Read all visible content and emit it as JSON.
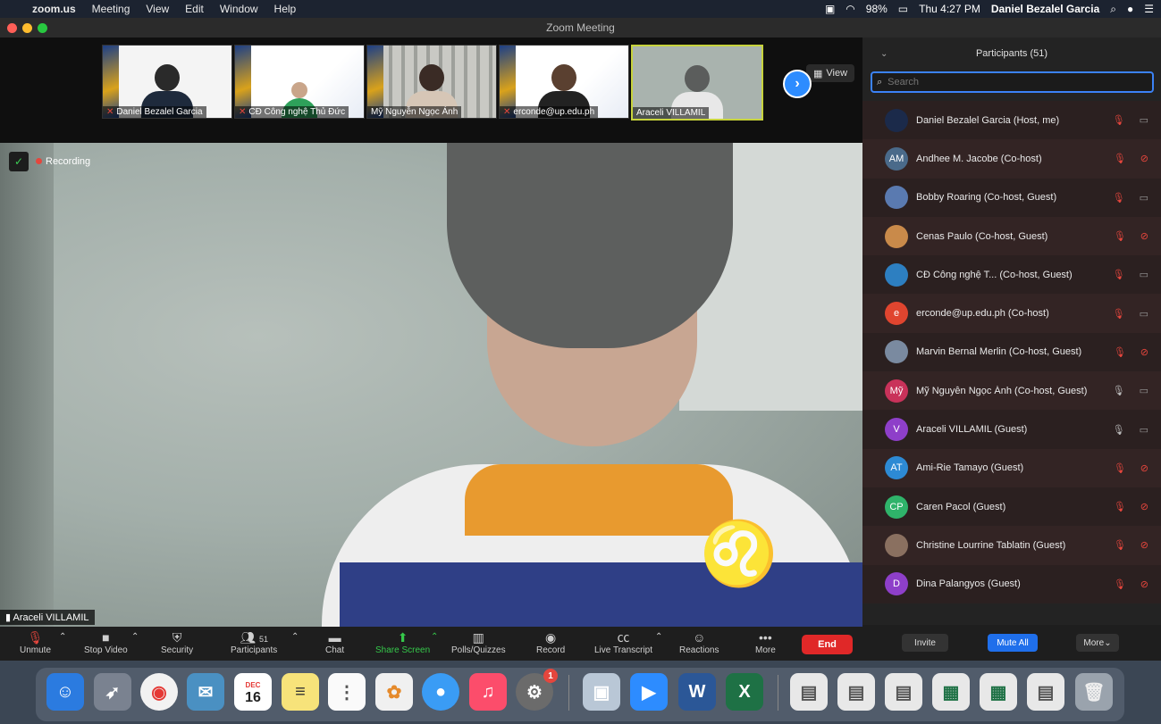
{
  "menubar": {
    "app": "zoom.us",
    "items": [
      "Meeting",
      "View",
      "Edit",
      "Window",
      "Help"
    ],
    "battery": "98%",
    "clock": "Thu 4:27 PM",
    "user": "Daniel Bezalel Garcia"
  },
  "window": {
    "title": "Zoom Meeting"
  },
  "thumbnails": [
    {
      "name": "Daniel Bezalel Garcia",
      "muted": true
    },
    {
      "name": "CĐ Công nghệ Thủ Đức",
      "muted": true
    },
    {
      "name": "Mỹ Nguyễn Ngọc Ánh",
      "muted": false
    },
    {
      "name": "erconde@up.edu.ph",
      "muted": true
    },
    {
      "name": "Araceli VILLAMIL",
      "muted": false
    }
  ],
  "stage": {
    "view_label": "View",
    "recording_label": "Recording",
    "active_speaker": "Araceli VILLAMIL"
  },
  "toolbar": {
    "unmute": "Unmute",
    "stop_video": "Stop Video",
    "security": "Security",
    "participants": "Participants",
    "participants_count": "51",
    "chat": "Chat",
    "share_screen": "Share Screen",
    "polls": "Polls/Quizzes",
    "record": "Record",
    "live_transcript": "Live Transcript",
    "reactions": "Reactions",
    "more": "More",
    "end": "End"
  },
  "participants_panel": {
    "title": "Participants (51)",
    "search_placeholder": "Search",
    "participants": [
      {
        "name": "Daniel Bezalel Garcia (Host, me)",
        "initials": "",
        "avatar_color": "#1b2a4a",
        "mic": "off",
        "cam": "on"
      },
      {
        "name": "Andhee M. Jacobe (Co-host)",
        "initials": "AM",
        "avatar_color": "#4a6a8a",
        "mic": "off",
        "cam": "off"
      },
      {
        "name": "Bobby Roaring (Co-host, Guest)",
        "initials": "",
        "avatar_color": "#5a7ab0",
        "mic": "off",
        "cam": "on"
      },
      {
        "name": "Cenas Paulo (Co-host, Guest)",
        "initials": "",
        "avatar_color": "#c98a4a",
        "mic": "off",
        "cam": "off"
      },
      {
        "name": "CĐ Công nghệ T... (Co-host, Guest)",
        "initials": "",
        "avatar_color": "#2d7fc1",
        "mic": "off",
        "cam": "on"
      },
      {
        "name": "erconde@up.edu.ph (Co-host)",
        "initials": "e",
        "avatar_color": "#e0452f",
        "mic": "off",
        "cam": "on"
      },
      {
        "name": "Marvin Bernal Merlin (Co-host, Guest)",
        "initials": "",
        "avatar_color": "#7a8aa0",
        "mic": "off",
        "cam": "off"
      },
      {
        "name": "Mỹ Nguyễn Ngọc Ánh  (Co-host, Guest)",
        "initials": "Mỹ",
        "avatar_color": "#c9325a",
        "mic": "on",
        "cam": "on"
      },
      {
        "name": "Araceli VILLAMIL (Guest)",
        "initials": "V",
        "avatar_color": "#8e3fc9",
        "mic": "on",
        "cam": "on"
      },
      {
        "name": "Ami-Rie Tamayo (Guest)",
        "initials": "AT",
        "avatar_color": "#2d8ad4",
        "mic": "off",
        "cam": "off"
      },
      {
        "name": "Caren Pacol (Guest)",
        "initials": "CP",
        "avatar_color": "#2fb36a",
        "mic": "off",
        "cam": "off"
      },
      {
        "name": "Christine Lourrine Tablatin (Guest)",
        "initials": "",
        "avatar_color": "#8a7060",
        "mic": "off",
        "cam": "off"
      },
      {
        "name": "Dina Palangyos (Guest)",
        "initials": "D",
        "avatar_color": "#8e3fc9",
        "mic": "off",
        "cam": "off"
      }
    ],
    "invite": "Invite",
    "mute_all": "Mute All",
    "more": "More"
  },
  "dock": {
    "calendar_month": "DEC",
    "calendar_day": "16",
    "updates_badge": "1"
  }
}
